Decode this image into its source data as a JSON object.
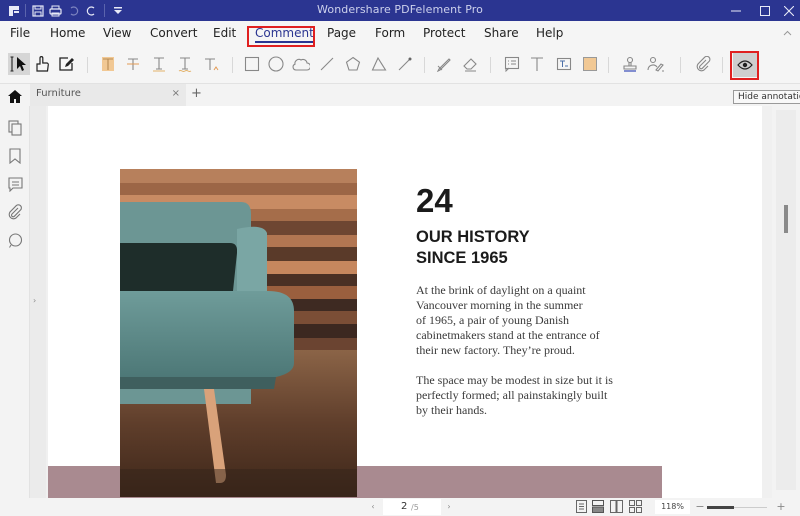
{
  "titlebar": {
    "title": "Wondershare PDFelement Pro",
    "quick_access": [
      "app-logo",
      "save",
      "print",
      "undo",
      "redo",
      "customize"
    ],
    "window_controls": [
      "minimize",
      "maximize",
      "close"
    ]
  },
  "menu": {
    "items": [
      {
        "label": "File"
      },
      {
        "label": "Home"
      },
      {
        "label": "View"
      },
      {
        "label": "Convert"
      },
      {
        "label": "Edit"
      },
      {
        "label": "Comment",
        "active": true
      },
      {
        "label": "Page"
      },
      {
        "label": "Form"
      },
      {
        "label": "Protect"
      },
      {
        "label": "Share"
      },
      {
        "label": "Help"
      }
    ],
    "highlight_color": "#e02020",
    "accent_color": "#2b3591"
  },
  "toolbar": {
    "tools": [
      "select-tool",
      "hand-tool",
      "edit-annotation-tool",
      "highlight",
      "strikethrough",
      "underline",
      "squiggly",
      "caret",
      "rectangle",
      "oval",
      "cloud",
      "line",
      "polygon",
      "polyline",
      "arrow",
      "pencil",
      "eraser",
      "note",
      "typewriter",
      "text-box",
      "area-highlight",
      "stamp",
      "signature",
      "attachment",
      "hide-annotations"
    ],
    "active_tool": "select-tool",
    "tooltip": "Hide annotations"
  },
  "tabs": {
    "items": [
      {
        "label": "Furniture",
        "close": "×"
      }
    ],
    "new_tab": "+"
  },
  "sidebar": {
    "items": [
      "thumbnails",
      "bookmarks",
      "comments",
      "attachments",
      "search"
    ]
  },
  "document": {
    "number": "24",
    "heading_line1": "OUR HISTORY",
    "heading_line2": "SINCE 1965",
    "para1": [
      "At the brink of daylight on a quaint",
      "Vancouver morning in the summer",
      "of 1965, a pair of young Danish",
      "cabinetmakers stand at the entrance of",
      "their new factory. They’re proud."
    ],
    "para2": [
      "The space may be modest in size but it is",
      "perfectly formed; all painstakingly built",
      "by their hands."
    ],
    "band_color": "#a98a90"
  },
  "status": {
    "current_page": "2",
    "total_pages": "/5",
    "zoom": "118%",
    "zoom_fraction": 0.45,
    "prev": "‹",
    "next": "›",
    "zoom_out": "−",
    "zoom_in": "+"
  }
}
